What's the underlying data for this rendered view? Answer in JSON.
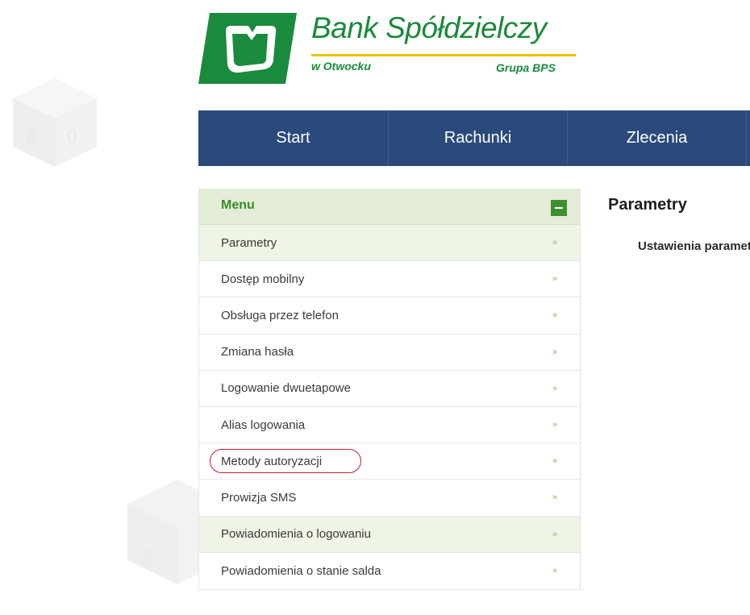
{
  "brand": {
    "name": "Bank Spółdzielczy",
    "city": "w Otwocku",
    "group": "Grupa BPS",
    "color_green": "#1a8a3c",
    "color_yellow": "#e8c200"
  },
  "topnav": {
    "tabs": [
      {
        "label": "Start"
      },
      {
        "label": "Rachunki"
      },
      {
        "label": "Zlecenia"
      }
    ],
    "background": "#2b4a7c"
  },
  "menu": {
    "title": "Menu",
    "toggle_icon": "minus-icon",
    "arrow_glyph": "»",
    "items": [
      {
        "label": "Parametry",
        "highlighted": true
      },
      {
        "label": "Dostęp mobilny",
        "highlighted": false
      },
      {
        "label": "Obsługa przez telefon",
        "highlighted": false
      },
      {
        "label": "Zmiana hasła",
        "highlighted": false
      },
      {
        "label": "Logowanie dwuetapowe",
        "highlighted": false
      },
      {
        "label": "Alias logowania",
        "highlighted": false
      },
      {
        "label": "Metody autoryzacji",
        "highlighted": false,
        "circled": true
      },
      {
        "label": "Prowizja SMS",
        "highlighted": false
      },
      {
        "label": "Powiadomienia o logowaniu",
        "highlighted": true
      },
      {
        "label": "Powiadomienia o stanie salda",
        "highlighted": false
      }
    ]
  },
  "content": {
    "title": "Parametry",
    "section": "Ustawienia parametrów"
  },
  "annotation_color": "#c0202a"
}
